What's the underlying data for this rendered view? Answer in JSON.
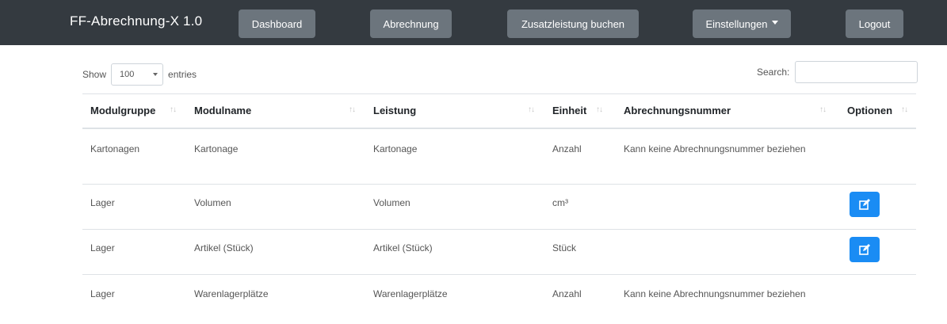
{
  "navbar": {
    "brand": "FF-Abrechnung-X 1.0",
    "items": [
      {
        "label": "Dashboard"
      },
      {
        "label": "Abrechnung"
      },
      {
        "label": "Zusatzleistung buchen"
      },
      {
        "label": "Einstellungen"
      },
      {
        "label": "Logout"
      }
    ]
  },
  "controls": {
    "show_label": "Show",
    "entries_value": "100",
    "entries_label": "entries",
    "search_label": "Search:",
    "search_value": ""
  },
  "table": {
    "columns": [
      "Modulgruppe",
      "Modulname",
      "Leistung",
      "Einheit",
      "Abrechnungsnummer",
      "Optionen"
    ],
    "rows": [
      {
        "modulgruppe": "Kartonagen",
        "modulname": "Kartonage",
        "leistung": "Kartonage",
        "einheit": "Anzahl",
        "abrechnungsnummer": "Kann keine Abrechnungsnummer beziehen",
        "edit": false
      },
      {
        "modulgruppe": "Lager",
        "modulname": "Volumen",
        "leistung": "Volumen",
        "einheit": "cm³",
        "abrechnungsnummer": "",
        "edit": true
      },
      {
        "modulgruppe": "Lager",
        "modulname": "Artikel (Stück)",
        "leistung": "Artikel (Stück)",
        "einheit": "Stück",
        "abrechnungsnummer": "",
        "edit": true
      },
      {
        "modulgruppe": "Lager",
        "modulname": "Warenlagerplätze",
        "leistung": "Warenlagerplätze",
        "einheit": "Anzahl",
        "abrechnungsnummer": "Kann keine Abrechnungsnummer beziehen",
        "edit": false
      }
    ]
  },
  "colors": {
    "navbar_bg": "#343a40",
    "nav_button_bg": "#6c757d",
    "edit_button_bg": "#1a8cf4"
  },
  "icons": {
    "sort": "sort-icon",
    "edit": "edit-icon",
    "dropdown": "caret-down-icon"
  }
}
